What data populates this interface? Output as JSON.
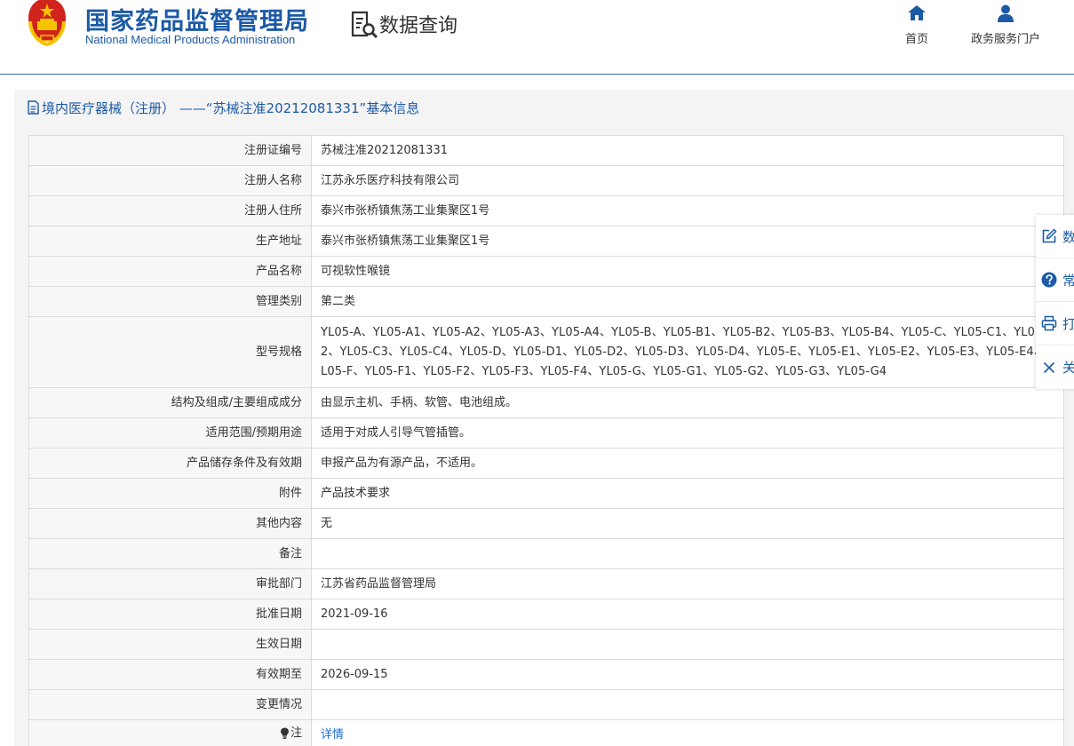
{
  "header": {
    "org_cn": "国家药品监督管理局",
    "org_en": "National Medical Products Administration",
    "query_label": "数据查询",
    "nav": [
      {
        "label": "首页",
        "icon": "home-icon"
      },
      {
        "label": "政务服务门户",
        "icon": "user-icon"
      }
    ]
  },
  "colors": {
    "brand": "#1c5aa6",
    "link": "#1c6fd0",
    "emblem_red": "#d0231b",
    "emblem_gold": "#f5c400"
  },
  "panel": {
    "title": "境内医疗器械（注册） ——“苏械注准20212081331”基本信息"
  },
  "rows": [
    {
      "label": "注册证编号",
      "value": "苏械注准20212081331"
    },
    {
      "label": "注册人名称",
      "value": "江苏永乐医疗科技有限公司"
    },
    {
      "label": "注册人住所",
      "value": "泰兴市张桥镇焦荡工业集聚区1号"
    },
    {
      "label": "生产地址",
      "value": "泰兴市张桥镇焦荡工业集聚区1号"
    },
    {
      "label": "产品名称",
      "value": "可视软性喉镜"
    },
    {
      "label": "管理类别",
      "value": "第二类"
    },
    {
      "label": "型号规格",
      "value": "YL05-A、YL05-A1、YL05-A2、YL05-A3、YL05-A4、YL05-B、YL05-B1、YL05-B2、YL05-B3、YL05-B4、YL05-C、YL05-C1、YL05-C2、YL05-C3、YL05-C4、YL05-D、YL05-D1、YL05-D2、YL05-D3、YL05-D4、YL05-E、YL05-E1、YL05-E2、YL05-E3、YL05-E4、YL05-F、YL05-F1、YL05-F2、YL05-F3、YL05-F4、YL05-G、YL05-G1、YL05-G2、YL05-G3、YL05-G4"
    },
    {
      "label": "结构及组成/主要组成成分",
      "value": "由显示主机、手柄、软管、电池组成。"
    },
    {
      "label": "适用范围/预期用途",
      "value": "适用于对成人引导气管插管。"
    },
    {
      "label": "产品储存条件及有效期",
      "value": "申报产品为有源产品，不适用。"
    },
    {
      "label": "附件",
      "value": "产品技术要求"
    },
    {
      "label": "其他内容",
      "value": "无"
    },
    {
      "label": "备注",
      "value": ""
    },
    {
      "label": "审批部门",
      "value": "江苏省药品监督管理局"
    },
    {
      "label": "批准日期",
      "value": "2021-09-16"
    },
    {
      "label": "生效日期",
      "value": ""
    },
    {
      "label": "有效期至",
      "value": "2026-09-15"
    },
    {
      "label": "变更情况",
      "value": ""
    }
  ],
  "note_row": {
    "label": "注",
    "link_text": "详情",
    "icon": "lightbulb-icon"
  },
  "sidebar": [
    {
      "label": "数",
      "icon": "edit-icon"
    },
    {
      "label": "常",
      "icon": "help-icon"
    },
    {
      "label": "打",
      "icon": "print-icon"
    },
    {
      "label": "关",
      "icon": "close-icon"
    }
  ]
}
